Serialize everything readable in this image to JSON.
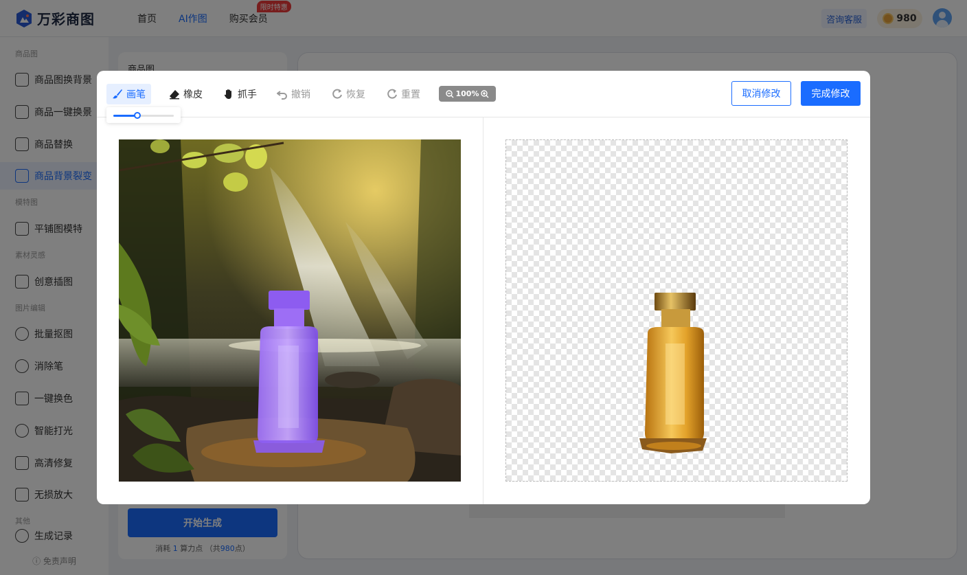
{
  "brand": {
    "name": "万彩商图"
  },
  "nav": {
    "items": [
      {
        "label": "首页"
      },
      {
        "label": "AI作图"
      },
      {
        "label": "购买会员"
      }
    ],
    "hot_badge": "限时特惠"
  },
  "header": {
    "service_label": "咨询客服",
    "points": "980"
  },
  "sidebar": {
    "groups": [
      {
        "title": "商品图",
        "items": [
          "商品图换背景",
          "商品一键换景",
          "商品替换",
          "商品背景裂变"
        ]
      },
      {
        "title": "模特图",
        "items": [
          "平铺图模特"
        ]
      },
      {
        "title": "素材灵感",
        "items": [
          "创意插图"
        ]
      },
      {
        "title": "图片编辑",
        "items": [
          "批量抠图",
          "消除笔",
          "一键换色",
          "智能打光",
          "高清修复",
          "无损放大"
        ]
      },
      {
        "title": "其他",
        "items": [
          "生成记录"
        ]
      }
    ],
    "active_item": "商品背景裂变",
    "disclaimer": "免责声明"
  },
  "left_panel": {
    "title": "商品图",
    "generate_label": "开始生成",
    "cost_prefix": "消耗",
    "cost_value": "1",
    "cost_unit": "算力点",
    "cost_total_prefix": "（共",
    "cost_total": "980",
    "cost_total_suffix": "点）"
  },
  "modal": {
    "tools": [
      {
        "label": "画笔",
        "icon": "brush-icon",
        "state": "active"
      },
      {
        "label": "橡皮",
        "icon": "eraser-icon",
        "state": "enabled"
      },
      {
        "label": "抓手",
        "icon": "hand-icon",
        "state": "enabled"
      },
      {
        "label": "撤销",
        "icon": "undo-icon",
        "state": "disabled"
      },
      {
        "label": "恢复",
        "icon": "redo-icon",
        "state": "disabled"
      },
      {
        "label": "重置",
        "icon": "reset-icon",
        "state": "disabled"
      }
    ],
    "zoom": "100%",
    "brush_size": 0.4,
    "cancel_label": "取消修改",
    "done_label": "完成修改"
  },
  "colors": {
    "primary": "#1a6cff",
    "mask_purple": "#8a5cf0",
    "perfume_gold": "#d99a1c"
  }
}
